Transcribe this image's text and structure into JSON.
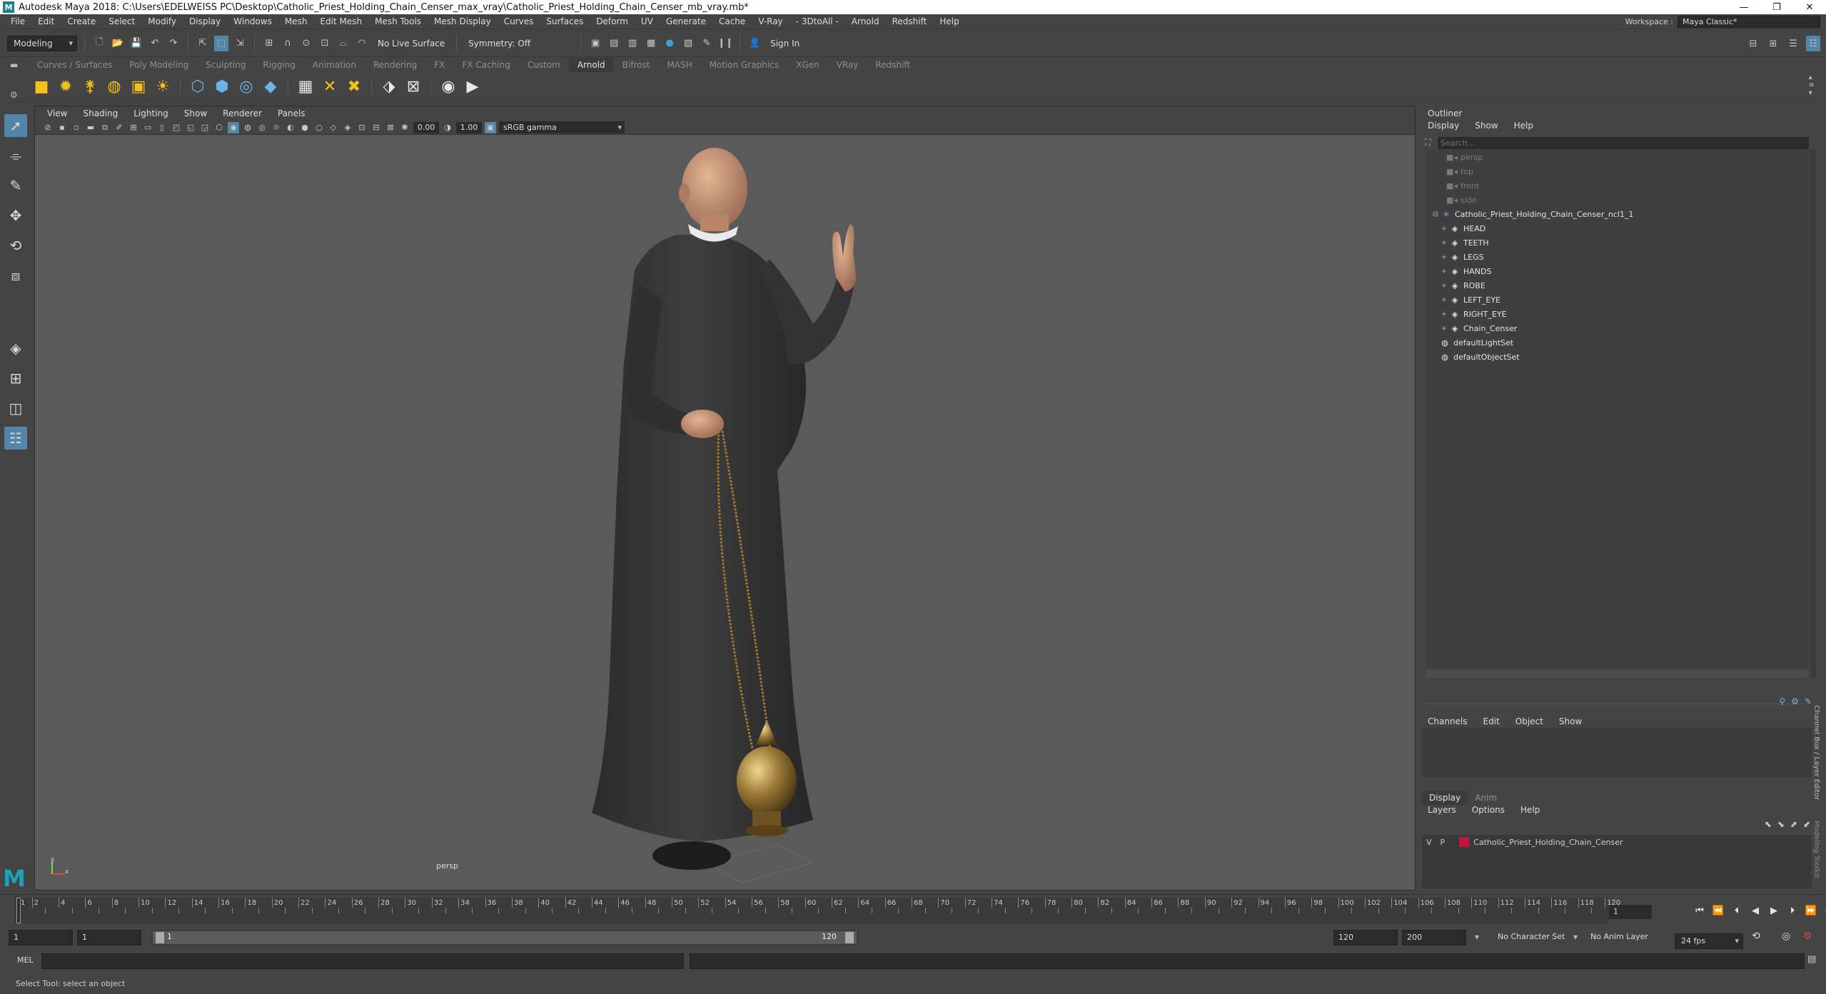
{
  "window": {
    "app_icon": "M",
    "title": "Autodesk Maya 2018: C:\\Users\\EDELWEISS PC\\Desktop\\Catholic_Priest_Holding_Chain_Censer_max_vray\\Catholic_Priest_Holding_Chain_Censer_mb_vray.mb*",
    "minimize": "—",
    "restore": "❐",
    "close": "✕"
  },
  "menubar": {
    "items": [
      "File",
      "Edit",
      "Create",
      "Select",
      "Modify",
      "Display",
      "Windows",
      "Mesh",
      "Edit Mesh",
      "Mesh Tools",
      "Mesh Display",
      "Curves",
      "Surfaces",
      "Deform",
      "UV",
      "Generate",
      "Cache",
      "V-Ray",
      "- 3DtoAll -",
      "Arnold",
      "Redshift",
      "Help"
    ],
    "workspace_label": "Workspace :",
    "workspace_value": "Maya Classic*"
  },
  "statusline": {
    "mode": "Modeling",
    "live_surface": "No Live Surface",
    "symmetry": "Symmetry: Off",
    "sign_in": "Sign In"
  },
  "shelf": {
    "tabs": [
      "Curves / Surfaces",
      "Poly Modeling",
      "Sculpting",
      "Rigging",
      "Animation",
      "Rendering",
      "FX",
      "FX Caching",
      "Custom",
      "Arnold",
      "Bifrost",
      "MASH",
      "Motion Graphics",
      "XGen",
      "VRay",
      "Redshift"
    ],
    "active_tab": "Arnold"
  },
  "viewport": {
    "menu": [
      "View",
      "Shading",
      "Lighting",
      "Show",
      "Renderer",
      "Panels"
    ],
    "exposure": "0.00",
    "gamma": "1.00",
    "color_space": "sRGB gamma",
    "camera_label": "persp",
    "axis_y": "y",
    "axis_x": "x"
  },
  "outliner": {
    "title": "Outliner",
    "menu": [
      "Display",
      "Show",
      "Help"
    ],
    "search_placeholder": "Search...",
    "items": [
      {
        "label": "persp",
        "type": "camera",
        "dim": true,
        "indent": 1
      },
      {
        "label": "top",
        "type": "camera",
        "dim": true,
        "indent": 1
      },
      {
        "label": "front",
        "type": "camera",
        "dim": true,
        "indent": 1
      },
      {
        "label": "side",
        "type": "camera",
        "dim": true,
        "indent": 1
      },
      {
        "label": "Catholic_Priest_Holding_Chain_Censer_ncl1_1",
        "type": "group",
        "dim": false,
        "indent": 0
      },
      {
        "label": "HEAD",
        "type": "mesh",
        "dim": false,
        "indent": 2
      },
      {
        "label": "TEETH",
        "type": "mesh",
        "dim": false,
        "indent": 2
      },
      {
        "label": "LEGS",
        "type": "mesh",
        "dim": false,
        "indent": 2
      },
      {
        "label": "HANDS",
        "type": "mesh",
        "dim": false,
        "indent": 2
      },
      {
        "label": "ROBE",
        "type": "mesh",
        "dim": false,
        "indent": 2
      },
      {
        "label": "LEFT_EYE",
        "type": "mesh",
        "dim": false,
        "indent": 2
      },
      {
        "label": "RIGHT_EYE",
        "type": "mesh",
        "dim": false,
        "indent": 2
      },
      {
        "label": "Chain_Censer",
        "type": "mesh",
        "dim": false,
        "indent": 2
      },
      {
        "label": "defaultLightSet",
        "type": "set",
        "dim": false,
        "indent": 1
      },
      {
        "label": "defaultObjectSet",
        "type": "set",
        "dim": false,
        "indent": 1
      }
    ]
  },
  "channelbox": {
    "menu": [
      "Channels",
      "Edit",
      "Object",
      "Show"
    ],
    "side_tab": "Channel Box / Layer Editor",
    "side_tab2": "Modeling Toolkit"
  },
  "layereditor": {
    "tabs": [
      "Display",
      "Anim"
    ],
    "menu": [
      "Layers",
      "Options",
      "Help"
    ],
    "layer": {
      "v": "V",
      "p": "P",
      "name": "Catholic_Priest_Holding_Chain_Censer",
      "color": "#c0163a"
    }
  },
  "timeline": {
    "ticks": [
      1,
      2,
      4,
      6,
      8,
      10,
      12,
      14,
      16,
      18,
      20,
      22,
      24,
      26,
      28,
      30,
      32,
      34,
      36,
      38,
      40,
      42,
      44,
      46,
      48,
      50,
      52,
      54,
      56,
      58,
      60,
      62,
      64,
      66,
      68,
      70,
      72,
      74,
      76,
      78,
      80,
      82,
      84,
      86,
      88,
      90,
      92,
      94,
      96,
      98,
      100,
      102,
      104,
      106,
      108,
      110,
      112,
      114,
      116,
      118,
      120
    ],
    "current_frame": "1"
  },
  "range": {
    "start": "1",
    "start2": "1",
    "slider_start": "1",
    "slider_end": "120",
    "end": "120",
    "end2": "200",
    "character_set": "No Character Set",
    "anim_layer": "No Anim Layer",
    "fps": "24 fps"
  },
  "commandline": {
    "label": "MEL"
  },
  "helpline": {
    "text": "Select Tool: select an object"
  },
  "colors": {
    "accent": "#5285a6",
    "layer_red": "#c0163a",
    "viewport_bg": "#5a5a5a"
  }
}
